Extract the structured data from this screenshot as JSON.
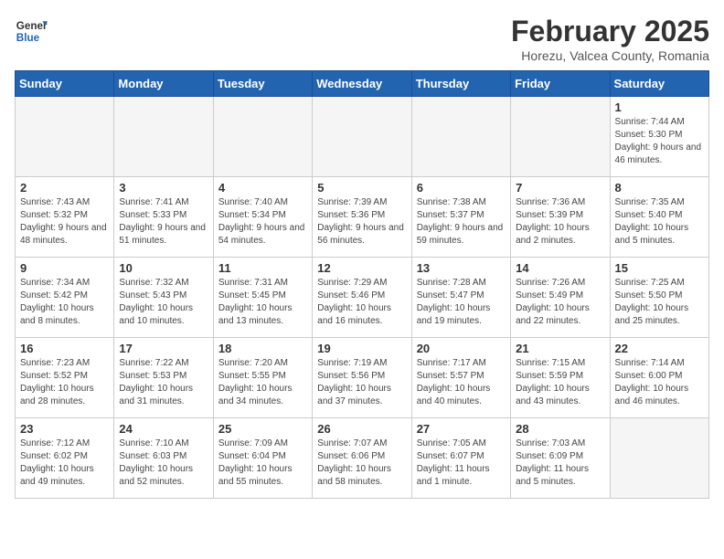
{
  "header": {
    "logo_general": "General",
    "logo_blue": "Blue",
    "title": "February 2025",
    "subtitle": "Horezu, Valcea County, Romania"
  },
  "weekdays": [
    "Sunday",
    "Monday",
    "Tuesday",
    "Wednesday",
    "Thursday",
    "Friday",
    "Saturday"
  ],
  "weeks": [
    [
      {
        "day": "",
        "info": ""
      },
      {
        "day": "",
        "info": ""
      },
      {
        "day": "",
        "info": ""
      },
      {
        "day": "",
        "info": ""
      },
      {
        "day": "",
        "info": ""
      },
      {
        "day": "",
        "info": ""
      },
      {
        "day": "1",
        "info": "Sunrise: 7:44 AM\nSunset: 5:30 PM\nDaylight: 9 hours and 46 minutes."
      }
    ],
    [
      {
        "day": "2",
        "info": "Sunrise: 7:43 AM\nSunset: 5:32 PM\nDaylight: 9 hours and 48 minutes."
      },
      {
        "day": "3",
        "info": "Sunrise: 7:41 AM\nSunset: 5:33 PM\nDaylight: 9 hours and 51 minutes."
      },
      {
        "day": "4",
        "info": "Sunrise: 7:40 AM\nSunset: 5:34 PM\nDaylight: 9 hours and 54 minutes."
      },
      {
        "day": "5",
        "info": "Sunrise: 7:39 AM\nSunset: 5:36 PM\nDaylight: 9 hours and 56 minutes."
      },
      {
        "day": "6",
        "info": "Sunrise: 7:38 AM\nSunset: 5:37 PM\nDaylight: 9 hours and 59 minutes."
      },
      {
        "day": "7",
        "info": "Sunrise: 7:36 AM\nSunset: 5:39 PM\nDaylight: 10 hours and 2 minutes."
      },
      {
        "day": "8",
        "info": "Sunrise: 7:35 AM\nSunset: 5:40 PM\nDaylight: 10 hours and 5 minutes."
      }
    ],
    [
      {
        "day": "9",
        "info": "Sunrise: 7:34 AM\nSunset: 5:42 PM\nDaylight: 10 hours and 8 minutes."
      },
      {
        "day": "10",
        "info": "Sunrise: 7:32 AM\nSunset: 5:43 PM\nDaylight: 10 hours and 10 minutes."
      },
      {
        "day": "11",
        "info": "Sunrise: 7:31 AM\nSunset: 5:45 PM\nDaylight: 10 hours and 13 minutes."
      },
      {
        "day": "12",
        "info": "Sunrise: 7:29 AM\nSunset: 5:46 PM\nDaylight: 10 hours and 16 minutes."
      },
      {
        "day": "13",
        "info": "Sunrise: 7:28 AM\nSunset: 5:47 PM\nDaylight: 10 hours and 19 minutes."
      },
      {
        "day": "14",
        "info": "Sunrise: 7:26 AM\nSunset: 5:49 PM\nDaylight: 10 hours and 22 minutes."
      },
      {
        "day": "15",
        "info": "Sunrise: 7:25 AM\nSunset: 5:50 PM\nDaylight: 10 hours and 25 minutes."
      }
    ],
    [
      {
        "day": "16",
        "info": "Sunrise: 7:23 AM\nSunset: 5:52 PM\nDaylight: 10 hours and 28 minutes."
      },
      {
        "day": "17",
        "info": "Sunrise: 7:22 AM\nSunset: 5:53 PM\nDaylight: 10 hours and 31 minutes."
      },
      {
        "day": "18",
        "info": "Sunrise: 7:20 AM\nSunset: 5:55 PM\nDaylight: 10 hours and 34 minutes."
      },
      {
        "day": "19",
        "info": "Sunrise: 7:19 AM\nSunset: 5:56 PM\nDaylight: 10 hours and 37 minutes."
      },
      {
        "day": "20",
        "info": "Sunrise: 7:17 AM\nSunset: 5:57 PM\nDaylight: 10 hours and 40 minutes."
      },
      {
        "day": "21",
        "info": "Sunrise: 7:15 AM\nSunset: 5:59 PM\nDaylight: 10 hours and 43 minutes."
      },
      {
        "day": "22",
        "info": "Sunrise: 7:14 AM\nSunset: 6:00 PM\nDaylight: 10 hours and 46 minutes."
      }
    ],
    [
      {
        "day": "23",
        "info": "Sunrise: 7:12 AM\nSunset: 6:02 PM\nDaylight: 10 hours and 49 minutes."
      },
      {
        "day": "24",
        "info": "Sunrise: 7:10 AM\nSunset: 6:03 PM\nDaylight: 10 hours and 52 minutes."
      },
      {
        "day": "25",
        "info": "Sunrise: 7:09 AM\nSunset: 6:04 PM\nDaylight: 10 hours and 55 minutes."
      },
      {
        "day": "26",
        "info": "Sunrise: 7:07 AM\nSunset: 6:06 PM\nDaylight: 10 hours and 58 minutes."
      },
      {
        "day": "27",
        "info": "Sunrise: 7:05 AM\nSunset: 6:07 PM\nDaylight: 11 hours and 1 minute."
      },
      {
        "day": "28",
        "info": "Sunrise: 7:03 AM\nSunset: 6:09 PM\nDaylight: 11 hours and 5 minutes."
      },
      {
        "day": "",
        "info": ""
      }
    ]
  ]
}
